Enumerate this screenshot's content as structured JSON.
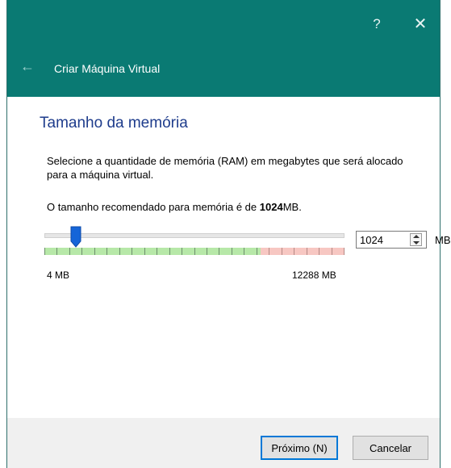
{
  "window": {
    "title": "Criar Máquina Virtual",
    "help_glyph": "?",
    "close_glyph": "✕",
    "back_glyph": "←",
    "accent_color": "#0a7a73"
  },
  "page": {
    "heading": "Tamanho da memória",
    "description": "Selecione a quantidade de memória (RAM) em megabytes que será alocado para a máquina virtual.",
    "recommended_prefix": "O tamanho recomendado para memória é de ",
    "recommended_value": "1024",
    "recommended_suffix": "MB."
  },
  "memory": {
    "value": "1024",
    "unit": "MB",
    "min_label": "4 MB",
    "max_label": "12288 MB",
    "min": 4,
    "max": 12288,
    "current": 1024,
    "safe_limit_fraction": 0.72
  },
  "buttons": {
    "next": "Próximo (N)",
    "cancel": "Cancelar"
  }
}
